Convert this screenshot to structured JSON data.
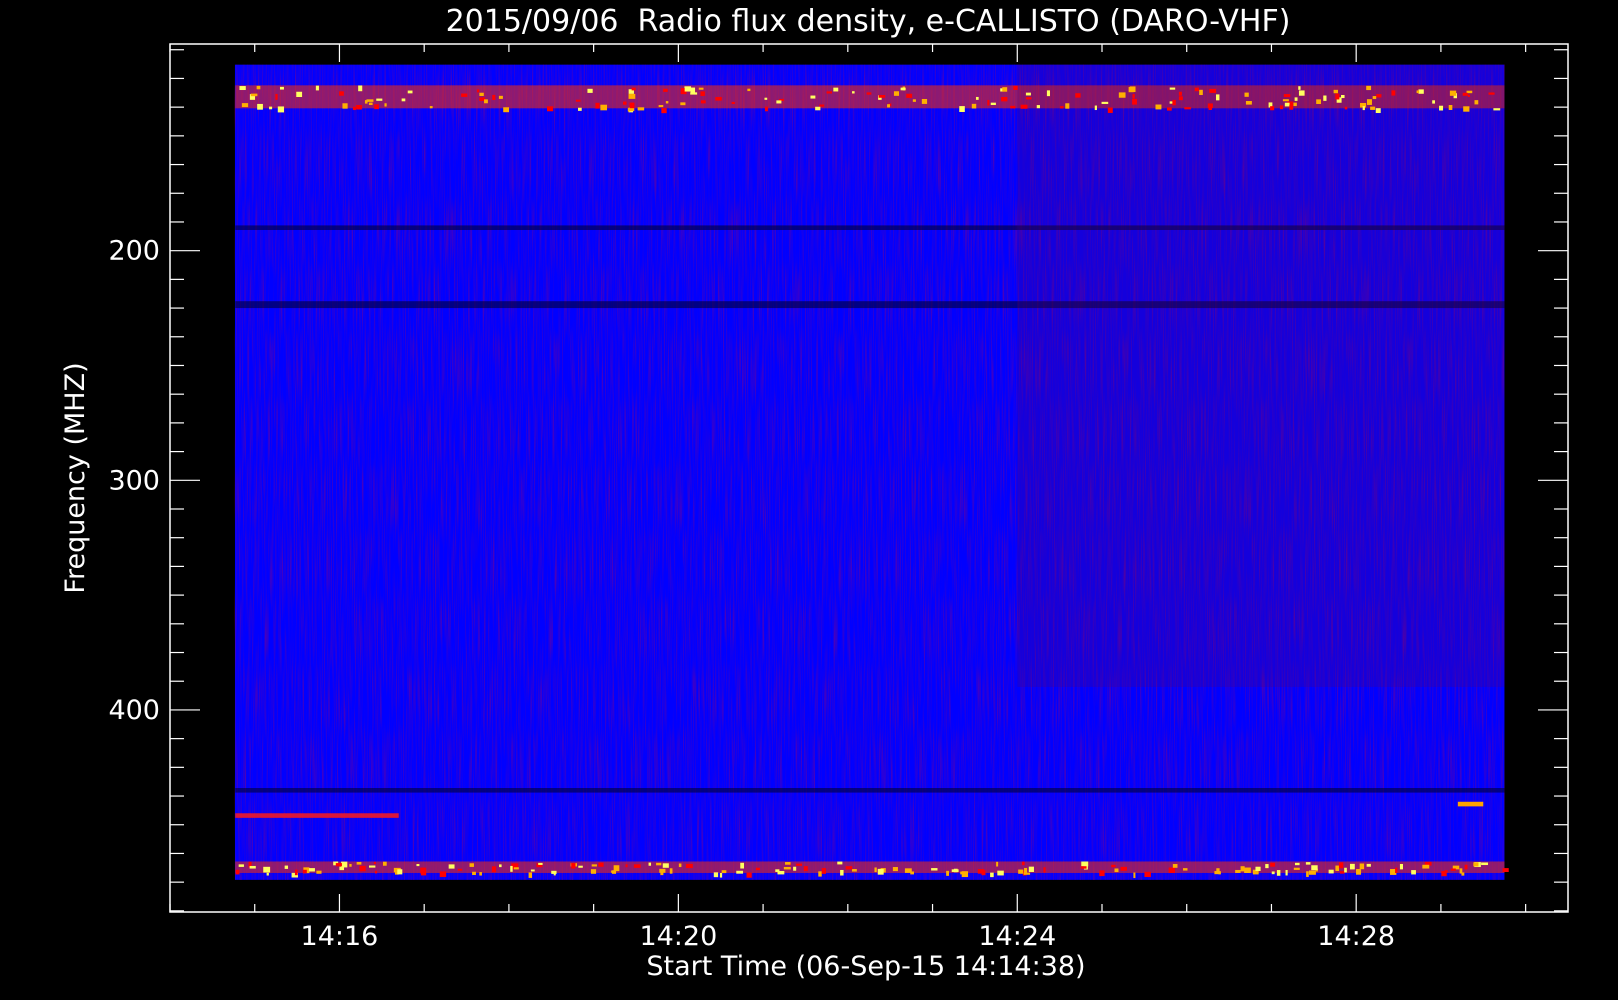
{
  "chart_data": {
    "type": "heatmap",
    "title": "2015/09/06  Radio flux density, e-CALLISTO (DARO-VHF)",
    "xlabel": "Start Time (06-Sep-15 14:14:38)",
    "ylabel": "Frequency (MHZ)",
    "x_ticks": [
      "14:16",
      "14:20",
      "14:24",
      "14:28"
    ],
    "x_tick_minutes": [
      16,
      20,
      24,
      28
    ],
    "x_range_minutes": [
      14.0,
      30.5
    ],
    "data_time_range_minutes": [
      14.7667,
      29.75
    ],
    "y_ticks": [
      200,
      300,
      400
    ],
    "y_range": [
      110,
      488
    ],
    "y_reversed": true,
    "data_freq_range": [
      119,
      474
    ],
    "colormap": [
      "#000000",
      "#0000ff",
      "#7a0000",
      "#ff0000",
      "#ffb000",
      "#ffff60"
    ],
    "background_color": "#0000ff",
    "features": [
      {
        "kind": "rfi_band_bright",
        "freq": [
          128,
          138
        ],
        "time": [
          14.77,
          29.75
        ]
      },
      {
        "kind": "rfi_band_bright",
        "freq": [
          466,
          471
        ],
        "time": [
          14.77,
          29.75
        ]
      },
      {
        "kind": "emission_line_red",
        "freq": [
          445,
          447
        ],
        "time": [
          14.77,
          16.7
        ]
      },
      {
        "kind": "dark_line",
        "freq": [
          222,
          225
        ],
        "time": [
          14.77,
          29.75
        ]
      },
      {
        "kind": "dark_line",
        "freq": [
          189,
          191
        ],
        "time": [
          14.77,
          29.75
        ]
      },
      {
        "kind": "dark_line",
        "freq": [
          434,
          436
        ],
        "time": [
          14.77,
          29.75
        ]
      },
      {
        "kind": "enhanced_region",
        "freq": [
          119,
          390
        ],
        "time": [
          24.0,
          29.75
        ]
      },
      {
        "kind": "emission_patch_orange",
        "freq": [
          440,
          442
        ],
        "time": [
          29.2,
          29.5
        ]
      }
    ]
  }
}
